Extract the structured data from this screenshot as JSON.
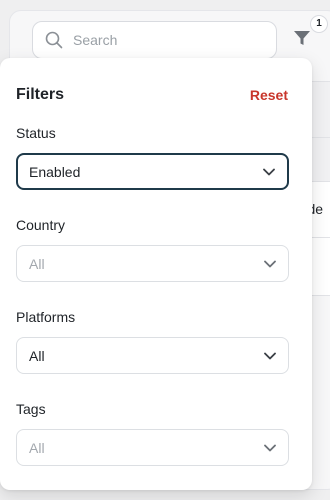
{
  "search": {
    "placeholder": "Search"
  },
  "filter_button": {
    "badge_count": "1"
  },
  "background_table": {
    "partial_cell_text": "orde"
  },
  "filters_panel": {
    "title": "Filters",
    "reset_label": "Reset",
    "fields": {
      "status": {
        "label": "Status",
        "value": "Enabled",
        "is_placeholder": false
      },
      "country": {
        "label": "Country",
        "value": "All",
        "is_placeholder": true
      },
      "platforms": {
        "label": "Platforms",
        "value": "All",
        "is_placeholder": false
      },
      "tags": {
        "label": "Tags",
        "value": "All",
        "is_placeholder": true
      }
    }
  },
  "colors": {
    "reset_text": "#c8362b",
    "active_border": "#1f3a4a",
    "placeholder_text": "#a3a8ae"
  },
  "icons": {
    "search": "search-icon",
    "filter": "funnel-icon",
    "chevron": "chevron-down-icon"
  }
}
